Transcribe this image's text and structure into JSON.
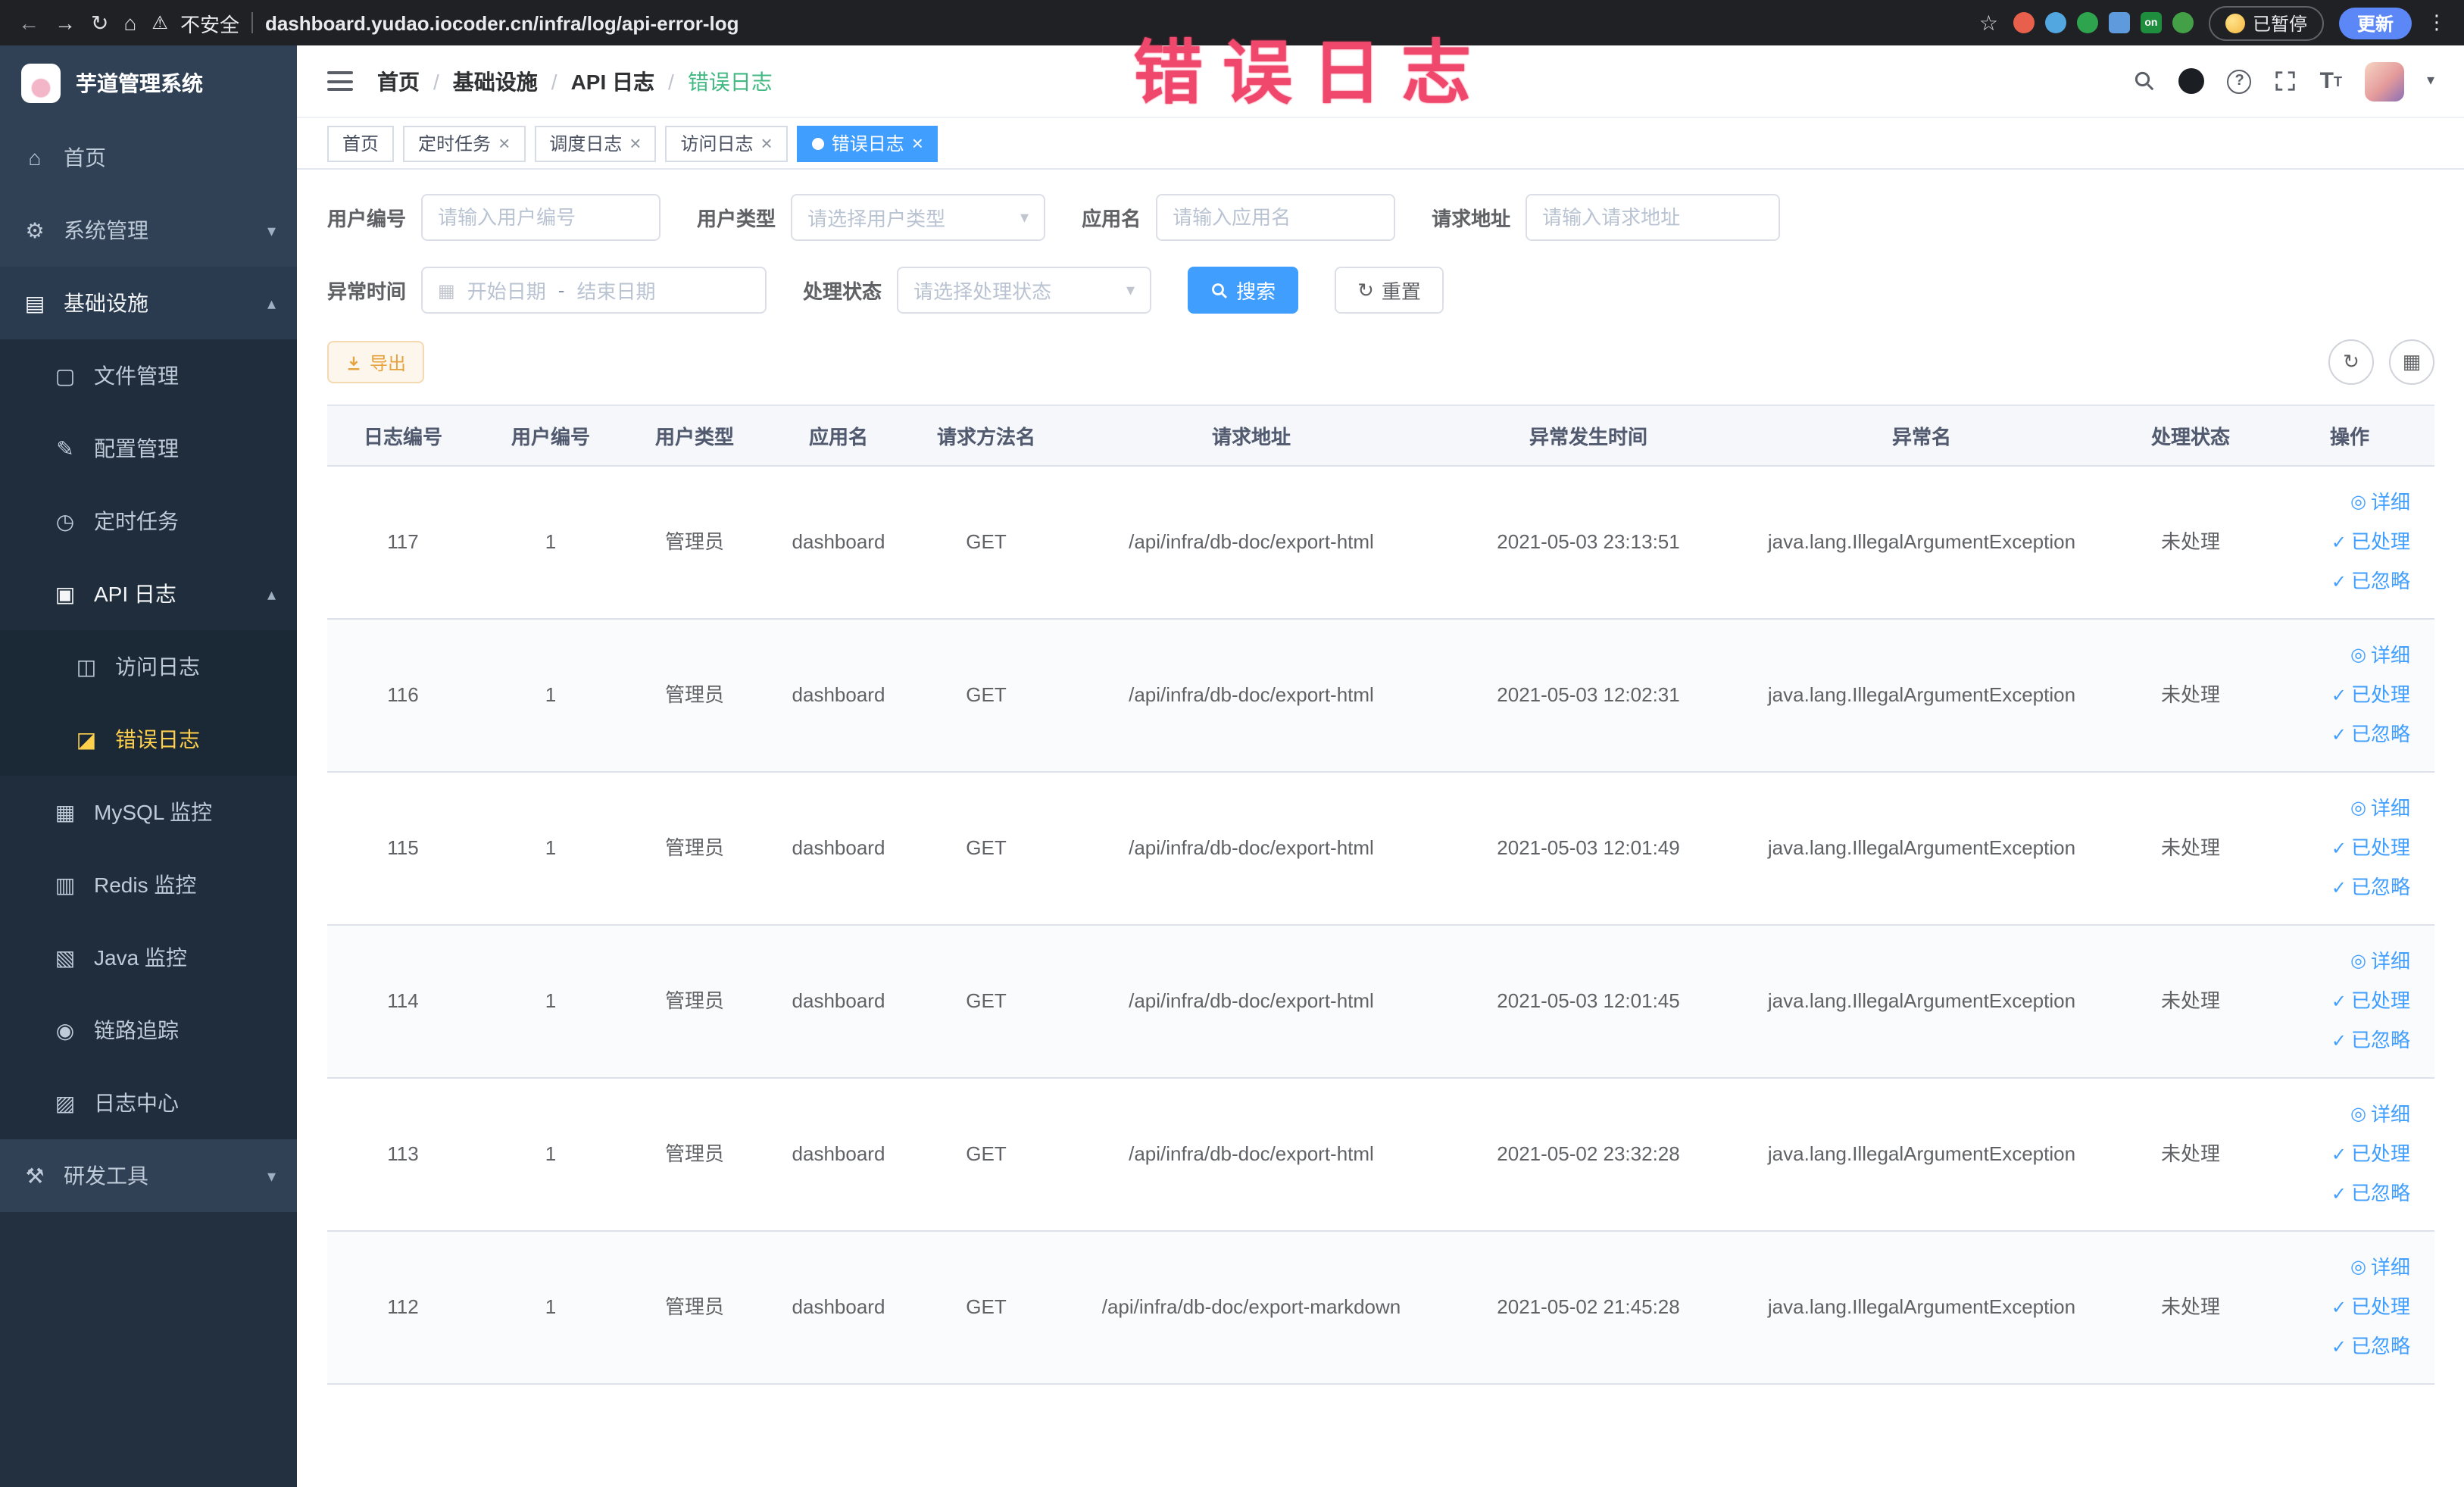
{
  "colors": {
    "accent": "#409eff",
    "sidebar_active": "#ffd04b",
    "warning": "#e6a23c",
    "breadcrumb_current": "#42b983",
    "watermark": "#f0486c",
    "link": "#409eff"
  },
  "watermark_text": "错误日志",
  "browser": {
    "security_label": "不安全",
    "url": "dashboard.yudao.iocoder.cn/infra/log/api-error-log",
    "paused_label": "已暂停",
    "update_label": "更新",
    "extension_icons": [
      {
        "color": "#e8604c",
        "shape": "circle"
      },
      {
        "color": "#53a7e0",
        "shape": "circle"
      },
      {
        "color": "#2ea44f",
        "shape": "circle"
      },
      {
        "color": "#5f9bdc",
        "shape": "square"
      },
      {
        "color": "#1e8e3e",
        "shape": "square",
        "text": "on"
      },
      {
        "color": "#43a047",
        "shape": "circle"
      }
    ]
  },
  "sidebar": {
    "logo_title": "芋道管理系统",
    "items": [
      {
        "key": "home",
        "label": "首页",
        "icon": "home",
        "level": 0
      },
      {
        "key": "system-mgmt",
        "label": "系统管理",
        "icon": "gear",
        "level": 0,
        "arrow": "down"
      },
      {
        "key": "infrastructure",
        "label": "基础设施",
        "icon": "infra",
        "level": 0,
        "arrow": "up",
        "open": true
      },
      {
        "key": "file-mgmt",
        "label": "文件管理",
        "icon": "file",
        "level": 1
      },
      {
        "key": "config-mgmt",
        "label": "配置管理",
        "icon": "config",
        "level": 1
      },
      {
        "key": "scheduled-jobs",
        "label": "定时任务",
        "icon": "timer",
        "level": 1
      },
      {
        "key": "api-log",
        "label": "API 日志",
        "icon": "api-log",
        "level": 1,
        "arrow": "up",
        "open": true
      },
      {
        "key": "access-log",
        "label": "访问日志",
        "icon": "access-log",
        "level": 2
      },
      {
        "key": "error-log",
        "label": "错误日志",
        "icon": "error-log",
        "level": 2,
        "active": true
      },
      {
        "key": "mysql-monitor",
        "label": "MySQL 监控",
        "icon": "mysql",
        "level": 1
      },
      {
        "key": "redis-monitor",
        "label": "Redis 监控",
        "icon": "redis",
        "level": 1
      },
      {
        "key": "java-monitor",
        "label": "Java 监控",
        "icon": "java",
        "level": 1
      },
      {
        "key": "tracing",
        "label": "链路追踪",
        "icon": "trace",
        "level": 1
      },
      {
        "key": "log-center",
        "label": "日志中心",
        "icon": "log-center",
        "level": 1
      },
      {
        "key": "dev-tools",
        "label": "研发工具",
        "icon": "devtools",
        "level": 0,
        "arrow": "down"
      }
    ]
  },
  "header": {
    "breadcrumb": [
      "首页",
      "基础设施",
      "API 日志",
      "错误日志"
    ]
  },
  "tabs": [
    {
      "label": "首页",
      "closable": false,
      "active": false
    },
    {
      "label": "定时任务",
      "closable": true,
      "active": false
    },
    {
      "label": "调度日志",
      "closable": true,
      "active": false
    },
    {
      "label": "访问日志",
      "closable": true,
      "active": false
    },
    {
      "label": "错误日志",
      "closable": true,
      "active": true
    }
  ],
  "filters": {
    "user_id": {
      "label": "用户编号",
      "placeholder": "请输入用户编号"
    },
    "user_type": {
      "label": "用户类型",
      "placeholder": "请选择用户类型"
    },
    "app_name": {
      "label": "应用名",
      "placeholder": "请输入应用名"
    },
    "request_url": {
      "label": "请求地址",
      "placeholder": "请输入请求地址"
    },
    "error_time": {
      "label": "异常时间",
      "start_placeholder": "开始日期",
      "separator": "-",
      "end_placeholder": "结束日期"
    },
    "process_status": {
      "label": "处理状态",
      "placeholder": "请选择处理状态"
    },
    "search_label": "搜索",
    "reset_label": "重置"
  },
  "toolbar": {
    "export_label": "导出"
  },
  "table": {
    "columns": [
      {
        "key": "log-id",
        "label": "日志编号"
      },
      {
        "key": "user-id",
        "label": "用户编号"
      },
      {
        "key": "user-type",
        "label": "用户类型"
      },
      {
        "key": "app-name",
        "label": "应用名"
      },
      {
        "key": "request-method",
        "label": "请求方法名"
      },
      {
        "key": "request-url",
        "label": "请求地址"
      },
      {
        "key": "error-time",
        "label": "异常发生时间"
      },
      {
        "key": "exception-name",
        "label": "异常名"
      },
      {
        "key": "process-status",
        "label": "处理状态"
      },
      {
        "key": "actions",
        "label": "操作"
      }
    ],
    "actions": [
      {
        "label": "详细",
        "icon": "eye",
        "name": "detail-link"
      },
      {
        "label": "已处理",
        "icon": "check",
        "name": "mark-processed-link"
      },
      {
        "label": "已忽略",
        "icon": "check",
        "name": "mark-ignored-link"
      }
    ],
    "rows": [
      {
        "id": "117",
        "user_id": "1",
        "user_type": "管理员",
        "app": "dashboard",
        "method": "GET",
        "url": "/api/infra/db-doc/export-html",
        "time": "2021-05-03 23:13:51",
        "exception": "java.lang.IllegalArgumentException",
        "status": "未处理"
      },
      {
        "id": "116",
        "user_id": "1",
        "user_type": "管理员",
        "app": "dashboard",
        "method": "GET",
        "url": "/api/infra/db-doc/export-html",
        "time": "2021-05-03 12:02:31",
        "exception": "java.lang.IllegalArgumentException",
        "status": "未处理"
      },
      {
        "id": "115",
        "user_id": "1",
        "user_type": "管理员",
        "app": "dashboard",
        "method": "GET",
        "url": "/api/infra/db-doc/export-html",
        "time": "2021-05-03 12:01:49",
        "exception": "java.lang.IllegalArgumentException",
        "status": "未处理"
      },
      {
        "id": "114",
        "user_id": "1",
        "user_type": "管理员",
        "app": "dashboard",
        "method": "GET",
        "url": "/api/infra/db-doc/export-html",
        "time": "2021-05-03 12:01:45",
        "exception": "java.lang.IllegalArgumentException",
        "status": "未处理"
      },
      {
        "id": "113",
        "user_id": "1",
        "user_type": "管理员",
        "app": "dashboard",
        "method": "GET",
        "url": "/api/infra/db-doc/export-html",
        "time": "2021-05-02 23:32:28",
        "exception": "java.lang.IllegalArgumentException",
        "status": "未处理"
      },
      {
        "id": "112",
        "user_id": "1",
        "user_type": "管理员",
        "app": "dashboard",
        "method": "GET",
        "url": "/api/infra/db-doc/export-markdown",
        "time": "2021-05-02 21:45:28",
        "exception": "java.lang.IllegalArgumentException",
        "status": "未处理"
      }
    ]
  }
}
